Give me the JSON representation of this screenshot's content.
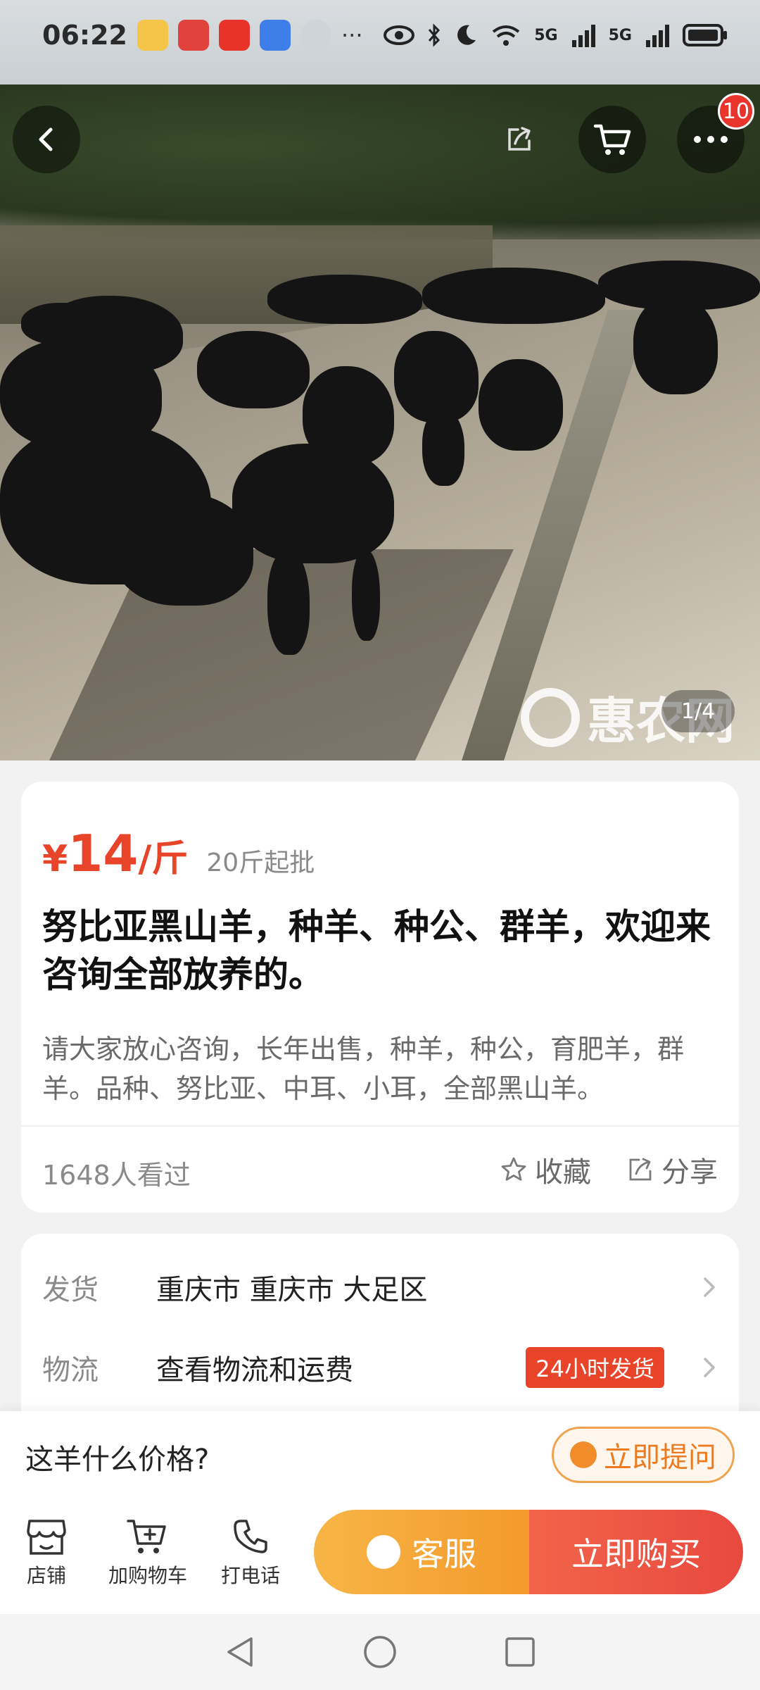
{
  "status_bar": {
    "time": "06:22",
    "network_1": "5G",
    "network_2": "5G"
  },
  "hero": {
    "page_indicator": "1/4",
    "watermark": "惠农网",
    "cart_badge_count": "10"
  },
  "product": {
    "price_symbol": "¥",
    "price_value": "14",
    "price_unit": "/斤",
    "min_order": "20斤起批",
    "title": "努比亚黑山羊，种羊、种公、群羊，欢迎来咨询全部放养的。",
    "description": "请大家放心咨询，长年出售，种羊，种公，育肥羊，群羊。品种、努比亚、中耳、小耳，全部黑山羊。",
    "views": "1648人看过",
    "favorite_label": "收藏",
    "share_label": "分享"
  },
  "shipping": {
    "ship_label": "发货",
    "ship_value": "重庆市 重庆市 大足区",
    "logistics_label": "物流",
    "logistics_value": "查看物流和运费",
    "logistics_tag": "24小时发货"
  },
  "qa": {
    "question": "这羊什么价格?",
    "ask_button": "立即提问"
  },
  "bottom_bar": {
    "shop_label": "店铺",
    "add_cart_label": "加购物车",
    "call_label": "打电话",
    "service_label": "客服",
    "buy_label": "立即购买"
  },
  "colors": {
    "price": "#e8442a",
    "service": "#f39a2b",
    "buy": "#e8493f"
  }
}
